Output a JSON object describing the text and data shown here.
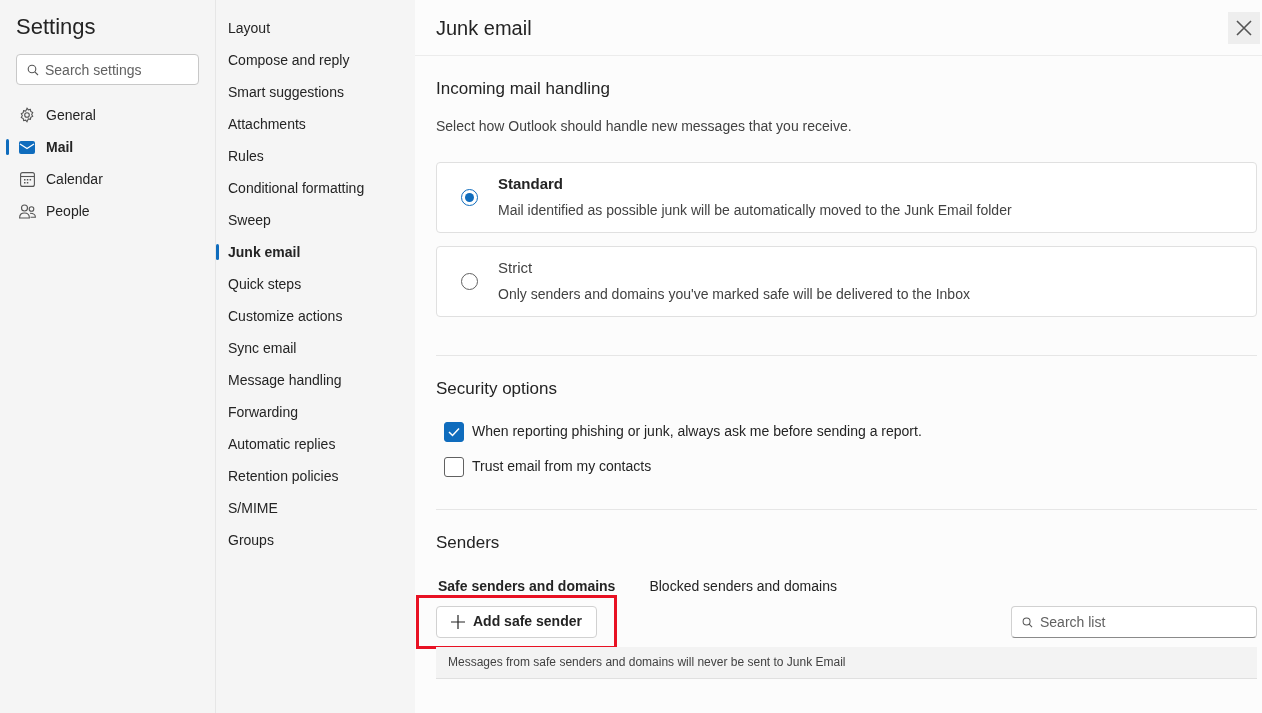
{
  "sidebar": {
    "title": "Settings",
    "search": {
      "placeholder": "Search settings"
    },
    "items": [
      {
        "label": "General",
        "kind": "gear",
        "selected": false
      },
      {
        "label": "Mail",
        "kind": "mail",
        "selected": true
      },
      {
        "label": "Calendar",
        "kind": "calendar",
        "selected": false
      },
      {
        "label": "People",
        "kind": "people",
        "selected": false
      }
    ]
  },
  "nav": {
    "items": [
      {
        "label": "Layout",
        "selected": false
      },
      {
        "label": "Compose and reply",
        "selected": false
      },
      {
        "label": "Smart suggestions",
        "selected": false
      },
      {
        "label": "Attachments",
        "selected": false
      },
      {
        "label": "Rules",
        "selected": false
      },
      {
        "label": "Conditional formatting",
        "selected": false
      },
      {
        "label": "Sweep",
        "selected": false
      },
      {
        "label": "Junk email",
        "selected": true
      },
      {
        "label": "Quick steps",
        "selected": false
      },
      {
        "label": "Customize actions",
        "selected": false
      },
      {
        "label": "Sync email",
        "selected": false
      },
      {
        "label": "Message handling",
        "selected": false
      },
      {
        "label": "Forwarding",
        "selected": false
      },
      {
        "label": "Automatic replies",
        "selected": false
      },
      {
        "label": "Retention policies",
        "selected": false
      },
      {
        "label": "S/MIME",
        "selected": false
      },
      {
        "label": "Groups",
        "selected": false
      }
    ]
  },
  "panel": {
    "title": "Junk email",
    "incoming": {
      "heading": "Incoming mail handling",
      "description": "Select how Outlook should handle new messages that you receive.",
      "options": [
        {
          "label": "Standard",
          "description": "Mail identified as possible junk will be automatically moved to the Junk Email folder",
          "selected": true
        },
        {
          "label": "Strict",
          "description": "Only senders and domains you've marked safe will be delivered to the Inbox",
          "selected": false
        }
      ]
    },
    "security": {
      "heading": "Security options",
      "options": [
        {
          "label": "When reporting phishing or junk, always ask me before sending a report.",
          "checked": true
        },
        {
          "label": "Trust email from my contacts",
          "checked": false
        }
      ]
    },
    "senders": {
      "heading": "Senders",
      "tabs": [
        {
          "label": "Safe senders and domains",
          "selected": true
        },
        {
          "label": "Blocked senders and domains",
          "selected": false
        }
      ],
      "add_button": {
        "label": "Add safe sender",
        "highlighted": true
      },
      "search": {
        "placeholder": "Search list"
      },
      "info": "Messages from safe senders and domains will never be sent to Junk Email"
    }
  }
}
